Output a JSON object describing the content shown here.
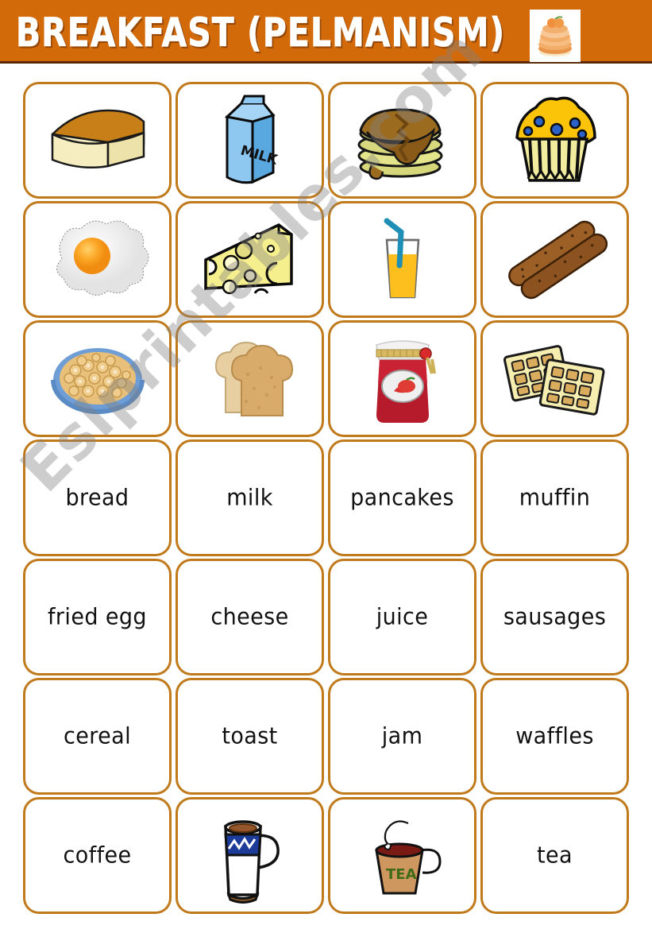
{
  "header": {
    "title": "BREAKFAST (PELMANISM)",
    "banner_color": "#d26a0a",
    "title_color": "#ffffff",
    "thumbnail_icon": "pancake-stack-icon"
  },
  "card_style": {
    "border_color": "#c07a1b",
    "background": "#ffffff"
  },
  "watermark": {
    "text": "Eslprintables.com",
    "color": "#828282"
  },
  "grid": {
    "columns": 4,
    "rows": 7,
    "cells": [
      {
        "type": "image",
        "icon": "bread-loaf-icon",
        "label": "bread"
      },
      {
        "type": "image",
        "icon": "milk-carton-icon",
        "label": "milk"
      },
      {
        "type": "image",
        "icon": "pancakes-icon",
        "label": "pancakes"
      },
      {
        "type": "image",
        "icon": "muffin-icon",
        "label": "muffin"
      },
      {
        "type": "image",
        "icon": "fried-egg-icon",
        "label": "fried egg"
      },
      {
        "type": "image",
        "icon": "cheese-wedge-icon",
        "label": "cheese"
      },
      {
        "type": "image",
        "icon": "juice-glass-icon",
        "label": "juice"
      },
      {
        "type": "image",
        "icon": "sausages-icon",
        "label": "sausages"
      },
      {
        "type": "image",
        "icon": "cereal-bowl-icon",
        "label": "cereal"
      },
      {
        "type": "image",
        "icon": "toast-icon",
        "label": "toast"
      },
      {
        "type": "image",
        "icon": "jam-jar-icon",
        "label": "jam"
      },
      {
        "type": "image",
        "icon": "waffles-icon",
        "label": "waffles"
      },
      {
        "type": "word",
        "text": "bread"
      },
      {
        "type": "word",
        "text": "milk"
      },
      {
        "type": "word",
        "text": "pancakes"
      },
      {
        "type": "word",
        "text": "muffin"
      },
      {
        "type": "word",
        "text": "fried egg"
      },
      {
        "type": "word",
        "text": "cheese"
      },
      {
        "type": "word",
        "text": "juice"
      },
      {
        "type": "word",
        "text": "sausages"
      },
      {
        "type": "word",
        "text": "cereal"
      },
      {
        "type": "word",
        "text": "toast"
      },
      {
        "type": "word",
        "text": "jam"
      },
      {
        "type": "word",
        "text": "waffles"
      },
      {
        "type": "word",
        "text": "coffee"
      },
      {
        "type": "image",
        "icon": "coffee-mug-icon",
        "label": "coffee"
      },
      {
        "type": "image",
        "icon": "tea-cup-icon",
        "label": "tea"
      },
      {
        "type": "word",
        "text": "tea"
      }
    ]
  },
  "tea_cup_label": "TEA",
  "milk_carton_label": "MILK"
}
